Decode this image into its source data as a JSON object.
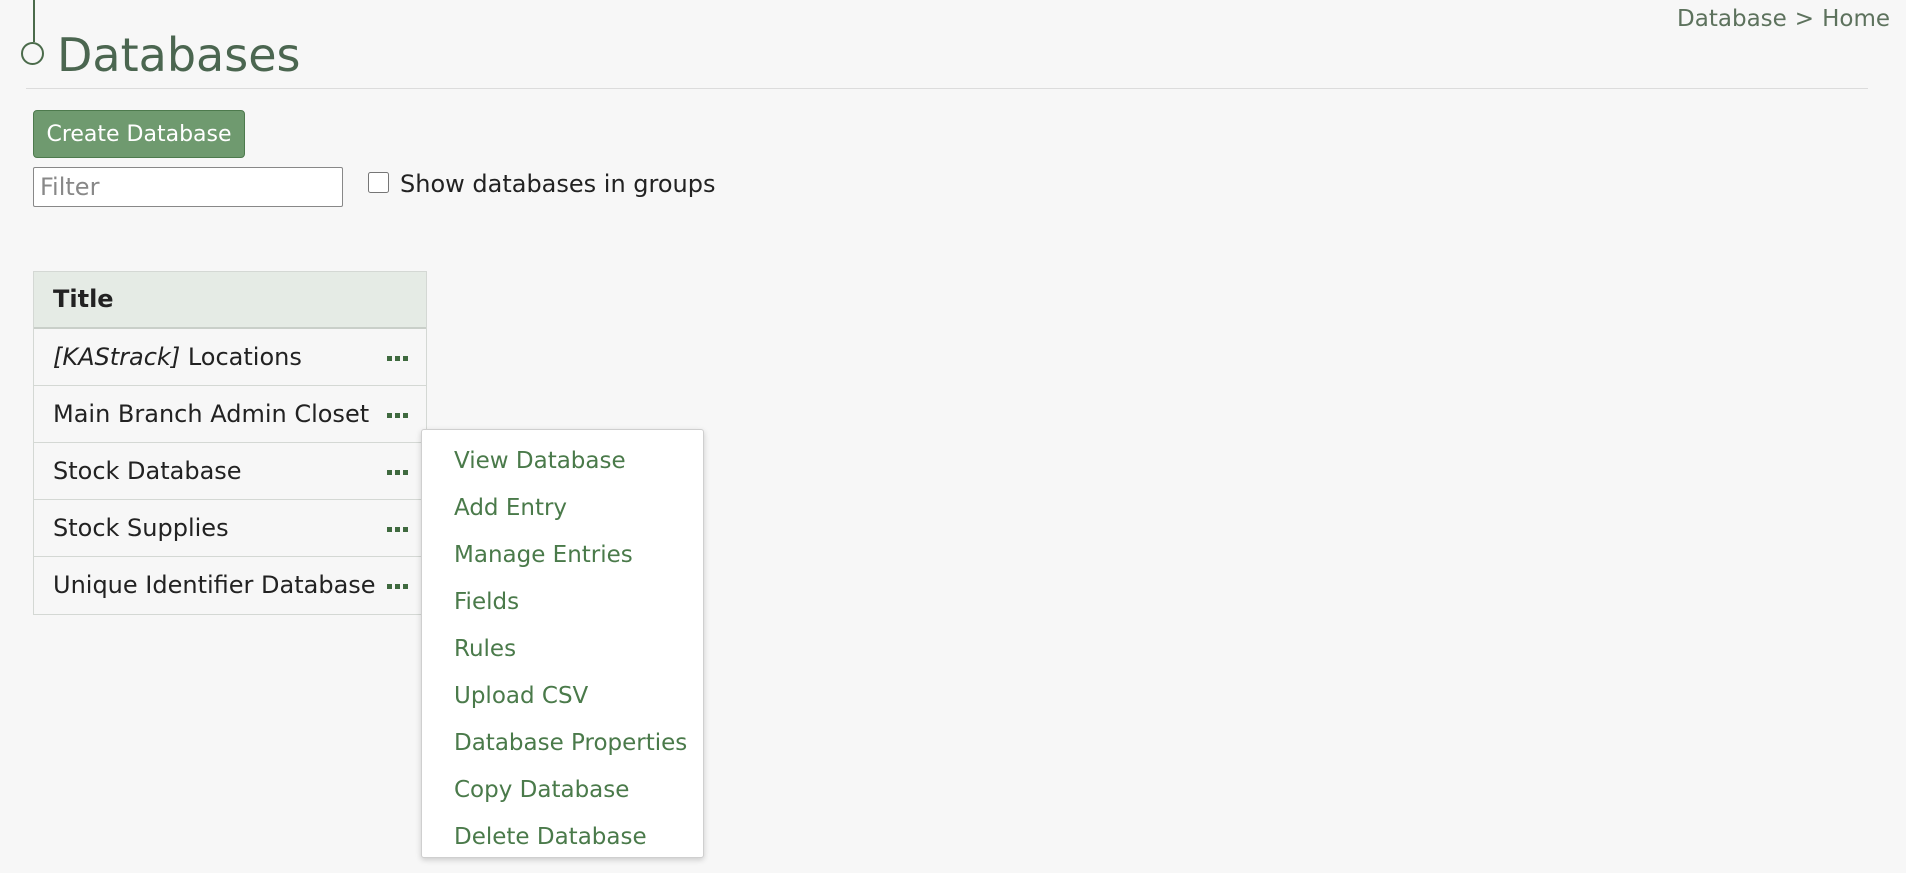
{
  "header": {
    "title": "Databases",
    "breadcrumb": [
      {
        "label": "Database"
      },
      {
        "label": "Home"
      }
    ],
    "breadcrumb_sep": ">"
  },
  "toolbar": {
    "create_label": "Create Database",
    "filter_placeholder": "Filter",
    "filter_value": "",
    "groups_label": "Show databases in groups",
    "groups_checked": false
  },
  "table": {
    "header": "Title",
    "rows": [
      {
        "tag": "[KAStrack]",
        "name": " Locations"
      },
      {
        "tag": "",
        "name": "Main Branch Admin Closet"
      },
      {
        "tag": "",
        "name": "Stock Database"
      },
      {
        "tag": "",
        "name": "Stock Supplies"
      },
      {
        "tag": "",
        "name": "Unique Identifier Database"
      }
    ]
  },
  "context_menu": {
    "items": [
      "View Database",
      "Add Entry",
      "Manage Entries",
      "Fields",
      "Rules",
      "Upload CSV",
      "Database Properties",
      "Copy Database",
      "Delete Database"
    ]
  },
  "colors": {
    "accent": "#4a7a4a",
    "button": "#6f9a6f",
    "title": "#4b6650"
  }
}
